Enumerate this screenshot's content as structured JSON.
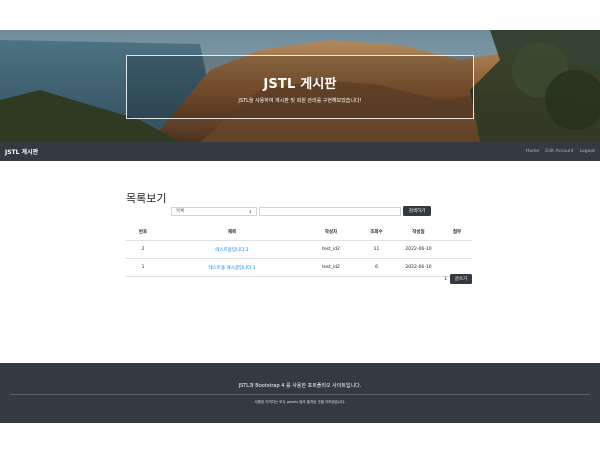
{
  "hero": {
    "title": "JSTL 게시판",
    "subtitle": "JSTL을 사용하여 게시판 및 회원 관리를 구현해보았습니다!"
  },
  "navbar": {
    "brand": "JSTL 게시판",
    "links": [
      "Home",
      "Edit Account",
      "Logout"
    ]
  },
  "main": {
    "heading": "목록보기",
    "search": {
      "selected_option": "목록",
      "query_value": "",
      "button_label": "검색하기"
    },
    "table": {
      "columns": [
        "번호",
        "제목",
        "작성자",
        "조회수",
        "작성일",
        "첨부"
      ],
      "rows": [
        {
          "no": "2",
          "title": "테스트용입니다 2",
          "author": "test_id2",
          "views": "11",
          "date": "2022-06-10",
          "attach": ""
        },
        {
          "no": "1",
          "title": "테스트용 게시글입니다 1",
          "author": "test_id2",
          "views": "6",
          "date": "2022-06-10",
          "attach": ""
        }
      ]
    },
    "pagination": {
      "current": "1"
    },
    "write_button": "글쓰기"
  },
  "footer": {
    "main_text": "JSTL과 Bootstrap 4 를 사용한 포트폴리오 사이트입니다.",
    "sub_text": "사용된 이미지는 모두 pexels 등의 출처된 곳을 이하였습니다."
  }
}
